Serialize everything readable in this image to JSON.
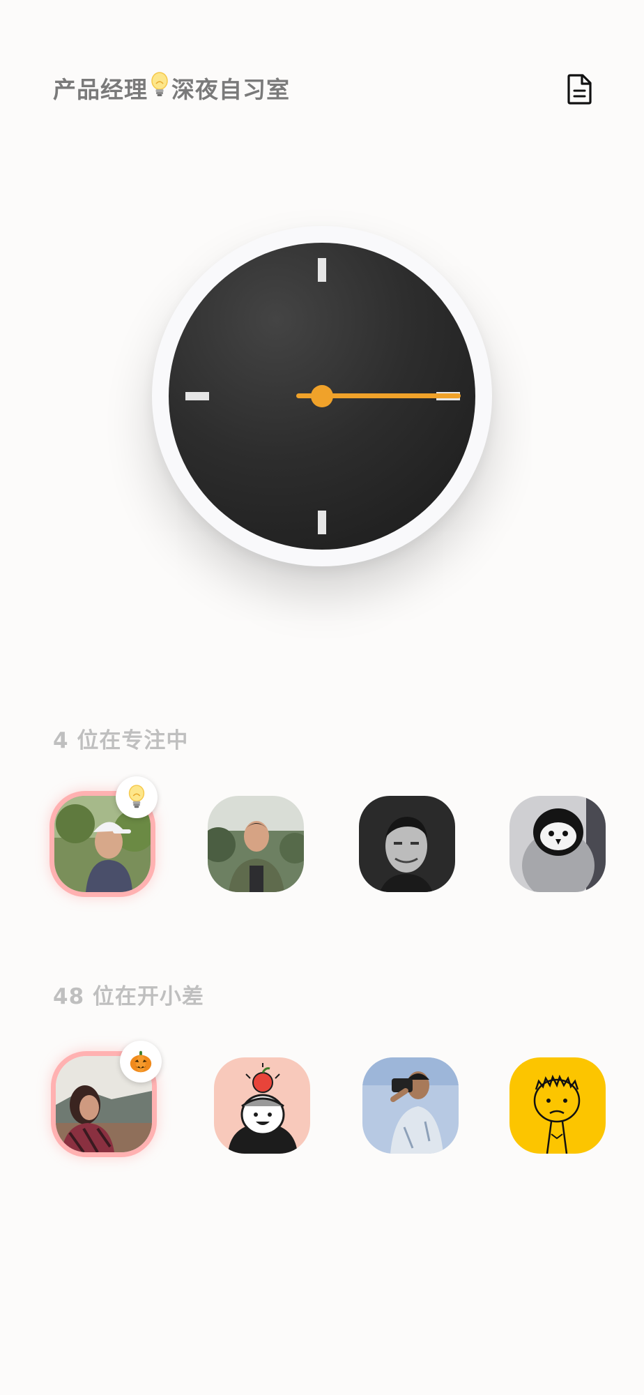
{
  "header": {
    "title_part1": "产品经理",
    "title_icon": "lightbulb-emoji",
    "title_part2": "深夜自习室",
    "doc_icon": "document-icon"
  },
  "clock": {
    "hand_color": "#f0a22a",
    "face_color": "#2d2d2d",
    "tick_color": "#e6e6e6"
  },
  "focusing": {
    "label": "4 位在专注中",
    "avatars": [
      {
        "name": "user-cap-profile",
        "status_icon": "lightbulb-emoji",
        "highlighted": true
      },
      {
        "name": "user-green-jacket"
      },
      {
        "name": "user-bw-portrait"
      },
      {
        "name": "user-penguin"
      }
    ]
  },
  "slacking": {
    "label": "48 位在开小差",
    "avatars": [
      {
        "name": "user-field-girl",
        "status_icon": "pumpkin-emoji",
        "highlighted": true
      },
      {
        "name": "user-apple-cartoon"
      },
      {
        "name": "user-photographer"
      },
      {
        "name": "user-yellow-doodle"
      }
    ]
  }
}
